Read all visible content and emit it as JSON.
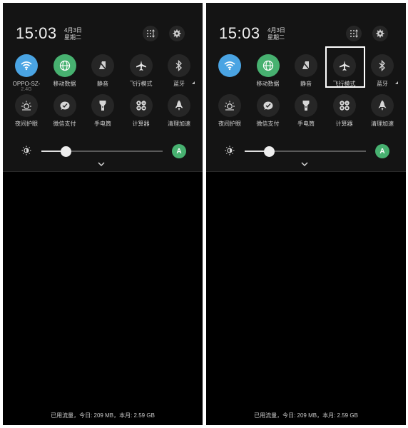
{
  "panels": [
    {
      "time": "15:03",
      "date_line1": "4月3日",
      "date_line2": "星期二",
      "tiles": [
        {
          "label": "OPPO-SZ-",
          "sub": "2.4G",
          "icon": "wifi-icon",
          "style": "blue"
        },
        {
          "label": "移动数据",
          "icon": "globe-icon",
          "style": "green"
        },
        {
          "label": "静音",
          "icon": "mute-icon",
          "style": "dark"
        },
        {
          "label": "飞行模式",
          "icon": "airplane-icon",
          "style": "dark"
        },
        {
          "label": "蓝牙",
          "icon": "bluetooth-icon",
          "style": "dark"
        },
        {
          "label": "夜间护眼",
          "icon": "eye-care-icon",
          "style": "dark"
        },
        {
          "label": "微信支付",
          "icon": "wechat-pay-icon",
          "style": "dark"
        },
        {
          "label": "手电筒",
          "icon": "flashlight-icon",
          "style": "dark"
        },
        {
          "label": "计算器",
          "icon": "calculator-icon",
          "style": "dark"
        },
        {
          "label": "清理加速",
          "icon": "rocket-icon",
          "style": "dark"
        }
      ],
      "brightness_level": 0.2,
      "auto_label": "A",
      "footer": "已用流量，今日: 209 MB，本月: 2.59 GB"
    },
    {
      "time": "15:03",
      "date_line1": "4月3日",
      "date_line2": "星期二",
      "tiles": [
        {
          "label": "",
          "icon": "wifi-icon",
          "style": "blue"
        },
        {
          "label": "移动数据",
          "icon": "globe-icon",
          "style": "green"
        },
        {
          "label": "静音",
          "icon": "mute-icon",
          "style": "dark"
        },
        {
          "label": "飞行模式",
          "icon": "airplane-icon",
          "style": "dark"
        },
        {
          "label": "蓝牙",
          "icon": "bluetooth-icon",
          "style": "dark"
        },
        {
          "label": "夜间护眼",
          "icon": "eye-care-icon",
          "style": "dark"
        },
        {
          "label": "微信支付",
          "icon": "wechat-pay-icon",
          "style": "dark"
        },
        {
          "label": "手电筒",
          "icon": "flashlight-icon",
          "style": "dark"
        },
        {
          "label": "计算器",
          "icon": "calculator-icon",
          "style": "dark"
        },
        {
          "label": "清理加速",
          "icon": "rocket-icon",
          "style": "dark"
        }
      ],
      "brightness_level": 0.2,
      "auto_label": "A",
      "footer": "已用流量，今日: 209 MB，本月: 2.59 GB",
      "highlighted_tile": "飞行模式"
    }
  ],
  "colors": {
    "panel_bg": "#000000",
    "header_bg": "#141414",
    "tile_dark": "#262626",
    "wifi_blue": "#4aa4e3",
    "accent_green": "#47b170"
  }
}
